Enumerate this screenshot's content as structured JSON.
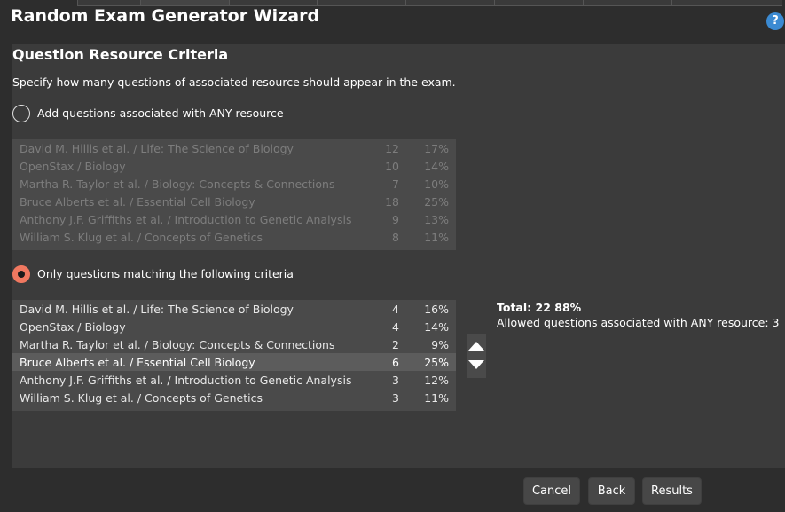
{
  "window": {
    "title": "Random Exam Generator Wizard",
    "help_icon": "question-mark-icon",
    "help_glyph": "?"
  },
  "section": {
    "title": "Question Resource Criteria",
    "instructions": "Specify how many questions of associated resource should appear in the exam."
  },
  "option_any": {
    "label": "Add questions associated with ANY resource",
    "selected": false,
    "rows": [
      {
        "name": "David M. Hillis et al. / Life: The Science of Biology",
        "count": "12",
        "percent": "17%"
      },
      {
        "name": "OpenStax / Biology",
        "count": "10",
        "percent": "14%"
      },
      {
        "name": "Martha R. Taylor et al. / Biology: Concepts & Connections",
        "count": "7",
        "percent": "10%"
      },
      {
        "name": "Bruce Alberts et al. / Essential Cell Biology",
        "count": "18",
        "percent": "25%"
      },
      {
        "name": "Anthony J.F. Griffiths et al. / Introduction to Genetic Analysis",
        "count": "9",
        "percent": "13%"
      },
      {
        "name": "William S. Klug et al. / Concepts of Genetics",
        "count": "8",
        "percent": "11%"
      }
    ]
  },
  "option_criteria": {
    "label": "Only questions matching the following criteria",
    "selected": true,
    "selected_row_index": 3,
    "rows": [
      {
        "name": "David M. Hillis et al. / Life: The Science of Biology",
        "count": "4",
        "percent": "16%"
      },
      {
        "name": "OpenStax / Biology",
        "count": "4",
        "percent": "14%"
      },
      {
        "name": "Martha R. Taylor et al. / Biology: Concepts & Connections",
        "count": "2",
        "percent": "9%"
      },
      {
        "name": "Bruce Alberts et al. / Essential Cell Biology",
        "count": "6",
        "percent": "25%"
      },
      {
        "name": "Anthony J.F. Griffiths et al. / Introduction to Genetic Analysis",
        "count": "3",
        "percent": "12%"
      },
      {
        "name": "William S. Klug et al. / Concepts of Genetics",
        "count": "3",
        "percent": "11%"
      }
    ]
  },
  "summary": {
    "total": "Total: 22 88%",
    "allowed": "Allowed questions associated with ANY resource: 3"
  },
  "buttons": {
    "cancel": "Cancel",
    "back": "Back",
    "results": "Results"
  },
  "colors": {
    "background": "#2d2d2d",
    "panel": "#3b3b3b",
    "table": "#4a4a4a",
    "selected_row": "#5c5c5c",
    "radio_accent": "#f07860",
    "help_icon": "#3b8ad2"
  }
}
